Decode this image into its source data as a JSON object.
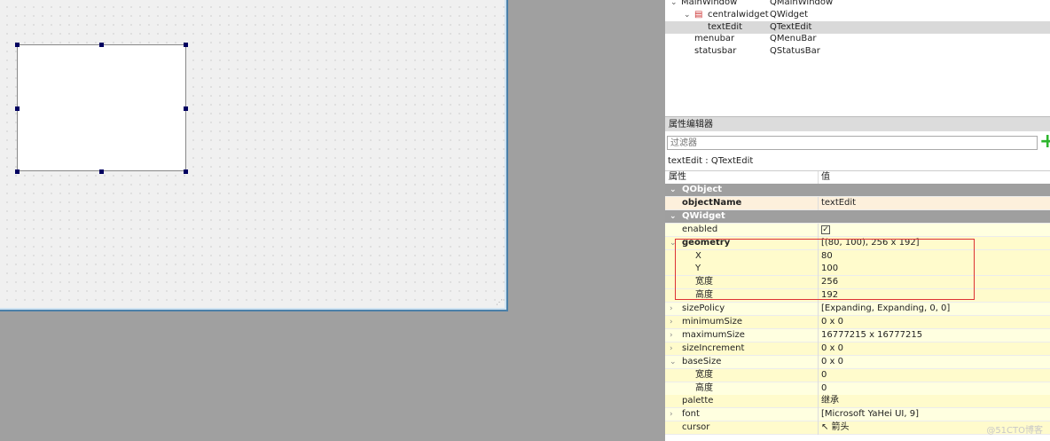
{
  "tree": [
    {
      "name": "MainWindow",
      "class": "QMainWindow",
      "depth": 0,
      "expanded": true
    },
    {
      "name": "centralwidget",
      "class": "QWidget",
      "depth": 1,
      "expanded": true,
      "icon": "widget-icon"
    },
    {
      "name": "textEdit",
      "class": "QTextEdit",
      "depth": 2,
      "selected": true
    },
    {
      "name": "menubar",
      "class": "QMenuBar",
      "depth": 1
    },
    {
      "name": "statusbar",
      "class": "QStatusBar",
      "depth": 1
    }
  ],
  "property_editor": {
    "title": "属性编辑器",
    "filter_placeholder": "过滤器",
    "object_label": "textEdit : QTextEdit",
    "col_property": "属性",
    "col_value": "值",
    "rows": [
      {
        "name": "QObject",
        "value": "",
        "type": "cat",
        "arrow": "v"
      },
      {
        "name": "objectName",
        "value": "textEdit",
        "type": "peach",
        "bold": true
      },
      {
        "name": "QWidget",
        "value": "",
        "type": "cat",
        "arrow": "v"
      },
      {
        "name": "enabled",
        "value": "✓",
        "type": "yel",
        "check": true
      },
      {
        "name": "geometry",
        "value": "[(80, 100), 256 x 192]",
        "type": "yel2",
        "bold": true,
        "arrow": "v"
      },
      {
        "name": "X",
        "value": "80",
        "type": "yel2",
        "sub": true
      },
      {
        "name": "Y",
        "value": "100",
        "type": "yel2",
        "sub": true
      },
      {
        "name": "宽度",
        "value": "256",
        "type": "yel2",
        "sub": true
      },
      {
        "name": "高度",
        "value": "192",
        "type": "yel2",
        "sub": true
      },
      {
        "name": "sizePolicy",
        "value": "[Expanding, Expanding, 0, 0]",
        "type": "yel",
        "arrow": ">"
      },
      {
        "name": "minimumSize",
        "value": "0 x 0",
        "type": "yel2",
        "arrow": ">"
      },
      {
        "name": "maximumSize",
        "value": "16777215 x 16777215",
        "type": "yel",
        "arrow": ">"
      },
      {
        "name": "sizeIncrement",
        "value": "0 x 0",
        "type": "yel2",
        "arrow": ">"
      },
      {
        "name": "baseSize",
        "value": "0 x 0",
        "type": "yel",
        "arrow": "v"
      },
      {
        "name": "宽度",
        "value": "0",
        "type": "yel2",
        "sub": true
      },
      {
        "name": "高度",
        "value": "0",
        "type": "yel",
        "sub": true
      },
      {
        "name": "palette",
        "value": "继承",
        "type": "yel2"
      },
      {
        "name": "font",
        "value": "[Microsoft YaHei UI, 9]",
        "type": "yel",
        "arrow": ">"
      },
      {
        "name": "cursor",
        "value": "↖ 箭头",
        "type": "yel2"
      }
    ]
  },
  "watermark": "@51CTO博客"
}
